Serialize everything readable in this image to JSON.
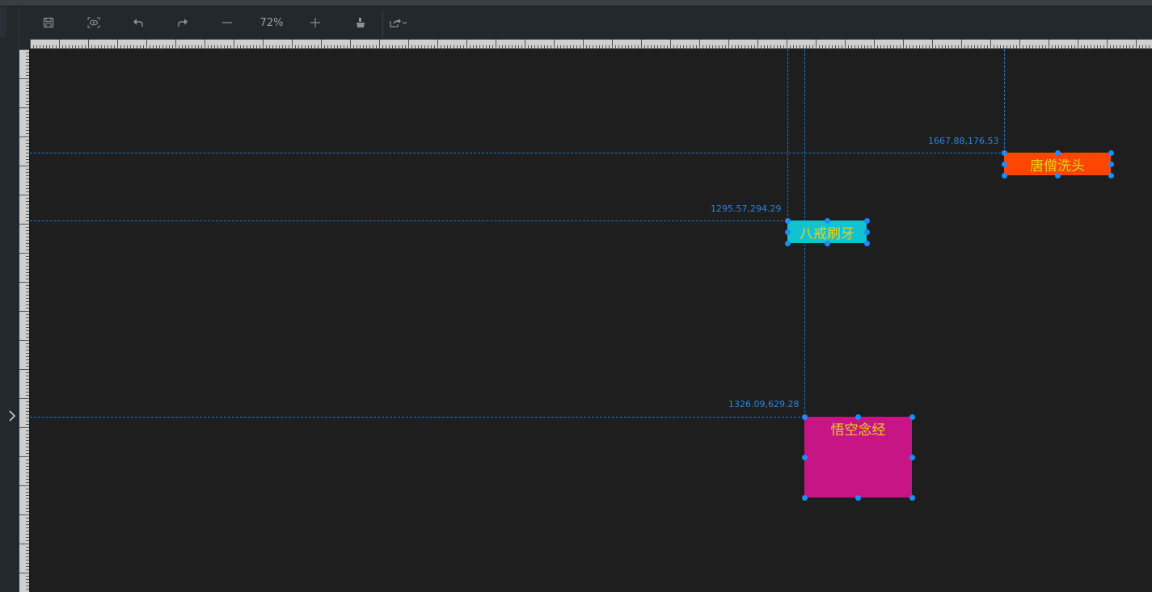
{
  "toolbar": {
    "zoom": "72%",
    "buttons": [
      "save-icon",
      "preview-icon",
      "undo-icon",
      "redo-icon",
      "zoom-out-icon",
      "zoom-in-icon",
      "clear-icon",
      "export-icon"
    ]
  },
  "nodes": [
    {
      "id": "tang",
      "label": "唐僧洗头",
      "coord": "1667.88,176.53",
      "bg": "#ff4500",
      "fg": "#e8d31c"
    },
    {
      "id": "bajie",
      "label": "八戒刷牙",
      "coord": "1295.57,294.29",
      "bg": "#11c3d1",
      "fg": "#e8d31c"
    },
    {
      "id": "wukong",
      "label": "悟空念经",
      "coord": "1326.09,629.28",
      "bg": "#c71585",
      "fg": "#e8d31c"
    }
  ],
  "colors": {
    "guide": "#1f78c8",
    "handle": "#1a8cff",
    "canvas": "#1e1e1e",
    "toolbar": "#23272e"
  }
}
